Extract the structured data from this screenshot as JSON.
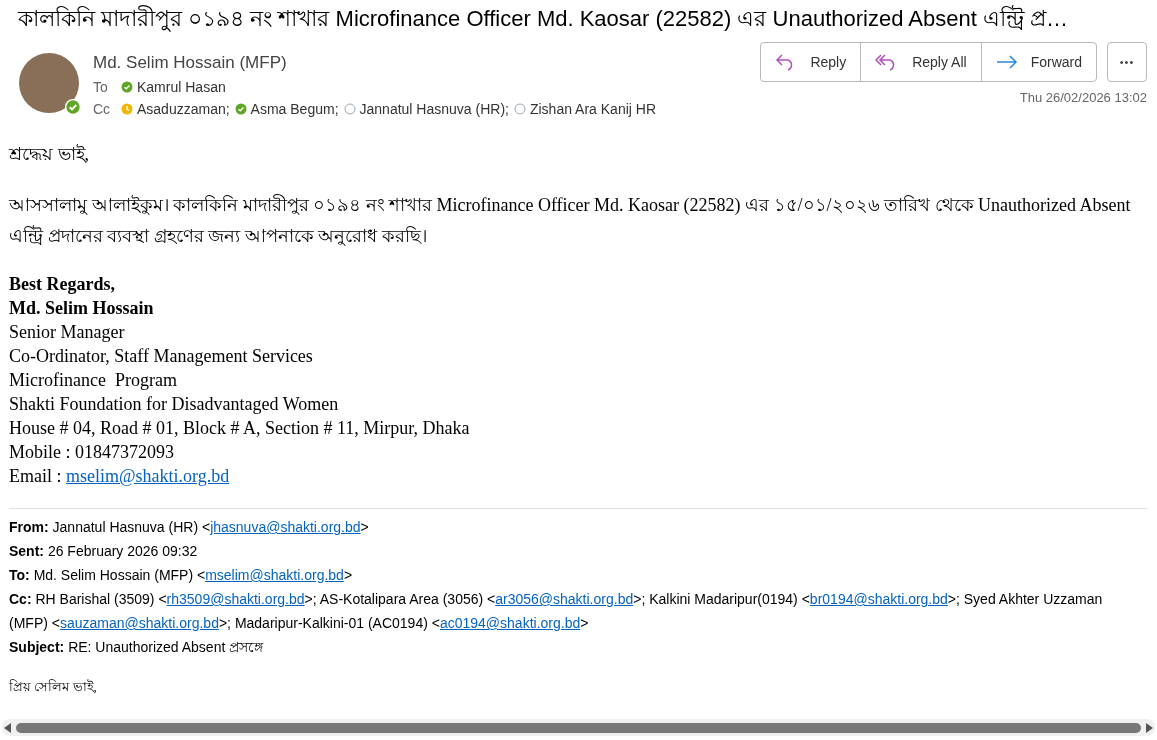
{
  "subject": "কালকিনি মাদারীপুর ০১৯৪ নং শাখার Microfinance Officer Md. Kaosar (22582) এর Unauthorized Absent এন্ট্রি প্র…",
  "sender": {
    "name": "Md. Selim Hossain (MFP)",
    "kind": "available"
  },
  "to_label": "To",
  "to": [
    {
      "name": "Kamrul Hasan",
      "kind": "available"
    }
  ],
  "cc_label": "Cc",
  "cc": [
    {
      "name": "Asaduzzaman;",
      "kind": "away"
    },
    {
      "name": "Asma Begum;",
      "kind": "available"
    },
    {
      "name": "Jannatul Hasnuva (HR);",
      "kind": "offline"
    },
    {
      "name": "Zishan Ara Kanij HR",
      "kind": "offline"
    }
  ],
  "actions": [
    {
      "label": "Reply",
      "kind": "reply"
    },
    {
      "label": "Reply All",
      "kind": "reply_all"
    },
    {
      "label": "Forward",
      "kind": "forward"
    }
  ],
  "more_button": "•••",
  "date": "Thu 26/02/2026 13:02",
  "greeting": "শ্রদ্ধেয় ভাই,",
  "paragraph": "আসসালামু আলাইকুম। কালকিনি মাদারীপুর ০১৯৪ নং শাখার Microfinance Officer Md. Kaosar (22582) এর ১৫/০১/২০২৬ তারিখ থেকে Unauthorized Absent এন্ট্রি প্রদানের ব্যবস্থা গ্রহণের জন্য আপনাকে অনুরোধ করছি।",
  "signature": [
    {
      "bold": true,
      "segments": [
        {
          "kind": "text",
          "text": "Best Regards,"
        }
      ]
    },
    {
      "bold": true,
      "segments": [
        {
          "kind": "text",
          "text": "Md. Selim Hossain"
        }
      ]
    },
    {
      "bold": false,
      "segments": [
        {
          "kind": "text",
          "text": "Senior Manager"
        }
      ]
    },
    {
      "bold": false,
      "segments": [
        {
          "kind": "text",
          "text": "Co-Ordinator, Staff Management Services"
        }
      ]
    },
    {
      "bold": false,
      "segments": [
        {
          "kind": "text",
          "text": "Microfinance  Program"
        }
      ]
    },
    {
      "bold": false,
      "segments": [
        {
          "kind": "text",
          "text": "Shakti Foundation for Disadvantaged Women"
        }
      ]
    },
    {
      "bold": false,
      "segments": [
        {
          "kind": "text",
          "text": "House # 04, Road # 01, Block # A, Section # 11, Mirpur, Dhaka"
        }
      ]
    },
    {
      "bold": false,
      "segments": [
        {
          "kind": "text",
          "text": "Mobile : 01847372093"
        }
      ]
    },
    {
      "bold": false,
      "segments": [
        {
          "kind": "text",
          "text": "Email : "
        },
        {
          "kind": "link",
          "text": "mselim@shakti.org.bd"
        }
      ]
    }
  ],
  "forwarded": [
    {
      "label": "From:",
      "segments": [
        {
          "kind": "text",
          "text": "Jannatul Hasnuva (HR) <"
        },
        {
          "kind": "link",
          "text": "jhasnuva@shakti.org.bd"
        },
        {
          "kind": "text",
          "text": ">"
        }
      ]
    },
    {
      "label": "Sent:",
      "segments": [
        {
          "kind": "text",
          "text": "26 February 2026 09:32"
        }
      ]
    },
    {
      "label": "To:",
      "segments": [
        {
          "kind": "text",
          "text": "Md. Selim Hossain (MFP) <"
        },
        {
          "kind": "link",
          "text": "mselim@shakti.org.bd"
        },
        {
          "kind": "text",
          "text": ">"
        }
      ]
    },
    {
      "label": "Cc:",
      "segments": [
        {
          "kind": "text",
          "text": "RH Barishal (3509) <"
        },
        {
          "kind": "link",
          "text": "rh3509@shakti.org.bd"
        },
        {
          "kind": "text",
          "text": ">; AS-Kotalipara Area (3056) <"
        },
        {
          "kind": "link",
          "text": "ar3056@shakti.org.bd"
        },
        {
          "kind": "text",
          "text": ">; Kalkini Madaripur(0194) <"
        },
        {
          "kind": "link",
          "text": "br0194@shakti.org.bd"
        },
        {
          "kind": "text",
          "text": ">; Syed Akhter Uzzaman (MFP) <"
        },
        {
          "kind": "link",
          "text": "sauzaman@shakti.org.bd"
        },
        {
          "kind": "text",
          "text": ">; Madaripur-Kalkini-01 (AC0194) <"
        },
        {
          "kind": "link",
          "text": "ac0194@shakti.org.bd"
        },
        {
          "kind": "text",
          "text": ">"
        }
      ]
    },
    {
      "label": "Subject:",
      "segments": [
        {
          "kind": "text",
          "text": "RE: Unauthorized Absent প্রসঙ্গে"
        }
      ]
    }
  ],
  "forwarded_greeting": "প্রিয় সেলিম ভাই,"
}
